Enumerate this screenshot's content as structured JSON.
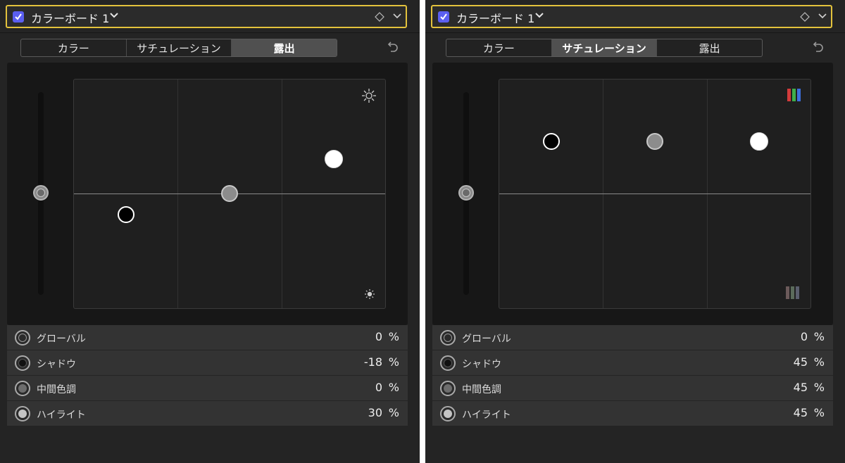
{
  "panels": [
    {
      "board_title": "カラーボード 1",
      "tabs": [
        "カラー",
        "サチュレーション",
        "露出"
      ],
      "active_tab": "露出",
      "corner_top_icon": "sun-large-icon",
      "corner_bottom_icon": "sun-small-icon",
      "pucks": {
        "global": 0,
        "shadow": -18,
        "midtone": 0,
        "highlight": 30
      },
      "rows": [
        {
          "label": "グローバル",
          "value": "0",
          "unit": "%"
        },
        {
          "label": "シャドウ",
          "value": "-18",
          "unit": "%"
        },
        {
          "label": "中間色調",
          "value": "0",
          "unit": "%"
        },
        {
          "label": "ハイライト",
          "value": "30",
          "unit": "%"
        }
      ]
    },
    {
      "board_title": "カラーボード 1",
      "tabs": [
        "カラー",
        "サチュレーション",
        "露出"
      ],
      "active_tab": "サチュレーション",
      "corner_top_icon": "saturation-color-bars-icon",
      "corner_bottom_icon": "saturation-gray-bars-icon",
      "pucks": {
        "global": 0,
        "shadow": 45,
        "midtone": 45,
        "highlight": 45
      },
      "rows": [
        {
          "label": "グローバル",
          "value": "0",
          "unit": "%"
        },
        {
          "label": "シャドウ",
          "value": "45",
          "unit": "%"
        },
        {
          "label": "中間色調",
          "value": "45",
          "unit": "%"
        },
        {
          "label": "ハイライト",
          "value": "45",
          "unit": "%"
        }
      ]
    }
  ],
  "colors": {
    "accent_border": "#e3c23c",
    "checkbox": "#5b5ff0",
    "panel_bg": "#242424"
  }
}
